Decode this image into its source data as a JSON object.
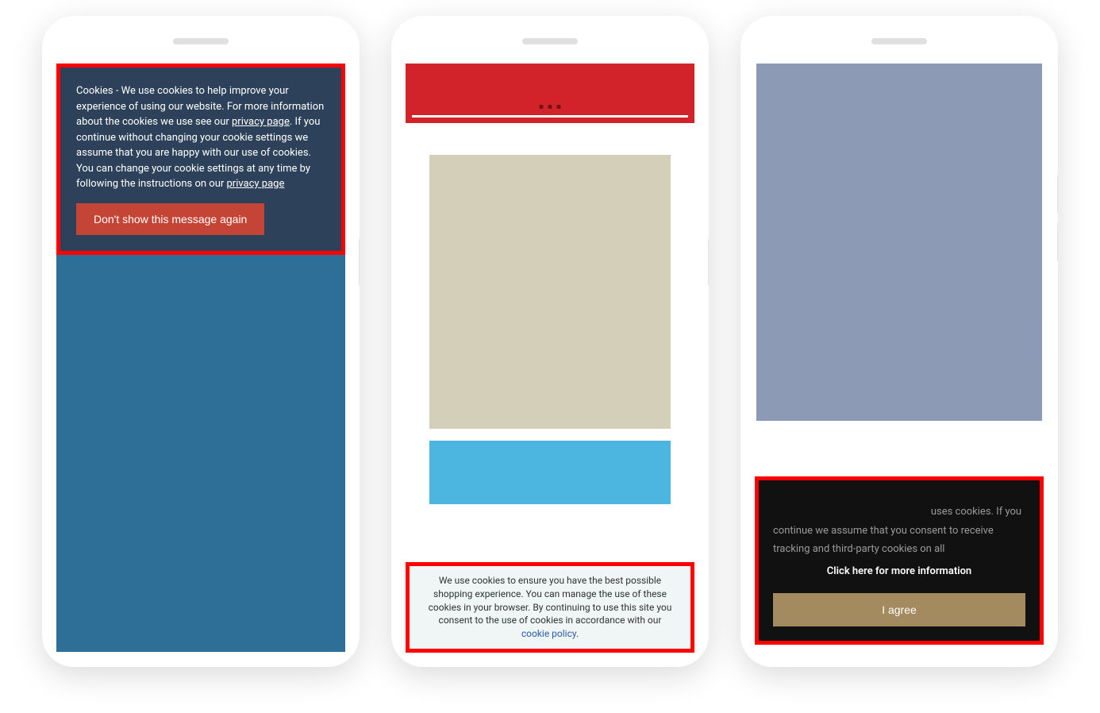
{
  "phone1": {
    "cookie_text_1": "Cookies - We use cookies to help improve your experience of using our website. For more information about the cookies we use see our ",
    "privacy_link_1": "privacy page",
    "cookie_text_2": ". If you continue without changing your cookie settings we assume that you are happy with our use of cookies. You can change your cookie settings at any time by following the instructions on our ",
    "privacy_link_2": "privacy page",
    "dismiss_label": "Don't show this message again"
  },
  "phone2": {
    "cookie_text_1": "We use cookies to ensure you have the best possible shopping experience. You can manage the use of these cookies in your browser. By continuing to use this site you consent to the use of cookies in accordance with our ",
    "cookie_policy_link": "cookie policy",
    "period": "."
  },
  "phone3": {
    "cookie_text_1": "uses cookies. If you continue we assume that you consent to receive tracking and third-party cookies on all",
    "more_info": "Click here for more information",
    "agree_label": "I agree"
  }
}
